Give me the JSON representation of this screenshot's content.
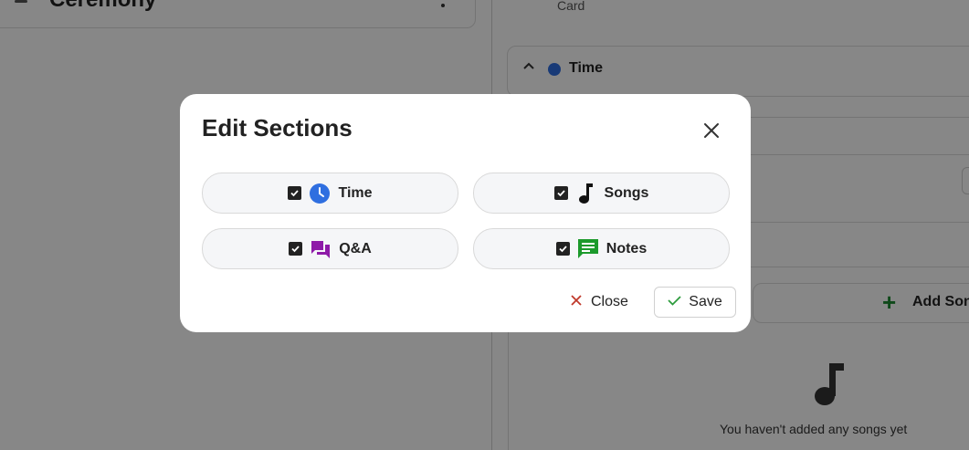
{
  "background": {
    "ceremony_title": "Ceremony",
    "card_label": "Card",
    "time_panel_title": "Time",
    "add_songs_label": "Add Songs",
    "empty_songs_message": "You haven't added any songs yet"
  },
  "modal": {
    "title": "Edit Sections",
    "sections": [
      {
        "label": "Time",
        "checked": true,
        "icon": "clock-icon",
        "color": "#2f6fe0"
      },
      {
        "label": "Songs",
        "checked": true,
        "icon": "music-note-icon",
        "color": "#111111"
      },
      {
        "label": "Q&A",
        "checked": true,
        "icon": "forum-icon",
        "color": "#8e1aa8"
      },
      {
        "label": "Notes",
        "checked": true,
        "icon": "chat-notes-icon",
        "color": "#1c9a2c"
      }
    ],
    "close_label": "Close",
    "save_label": "Save"
  },
  "colors": {
    "overlay": "rgba(0,0,0,0.47)",
    "close_x": "#c0392b",
    "save_check": "#2e9c3e",
    "add_plus": "#1d8a32"
  }
}
